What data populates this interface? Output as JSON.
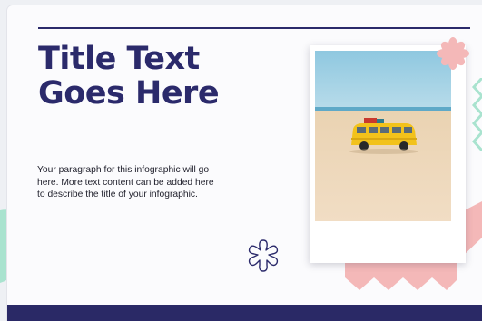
{
  "slide": {
    "title_line1": "Title Text",
    "title_line2": "Goes Here",
    "paragraph_lines": [
      "Your paragraph for this infographic will go",
      "here. More text content can be added here",
      "to describe the title of your infographic."
    ]
  },
  "photo": {
    "subject": "yellow van on a sandy beach under a blue sky"
  },
  "icons": {
    "outline_flower": "flower-outline-icon",
    "pink_flower": "pink-flower-icon"
  },
  "colors": {
    "title": "#2b2a6b",
    "footer": "#2a2966",
    "accent_pink": "#f4b8b8",
    "accent_mint": "#a9e3cf",
    "van": "#f2c21b"
  }
}
